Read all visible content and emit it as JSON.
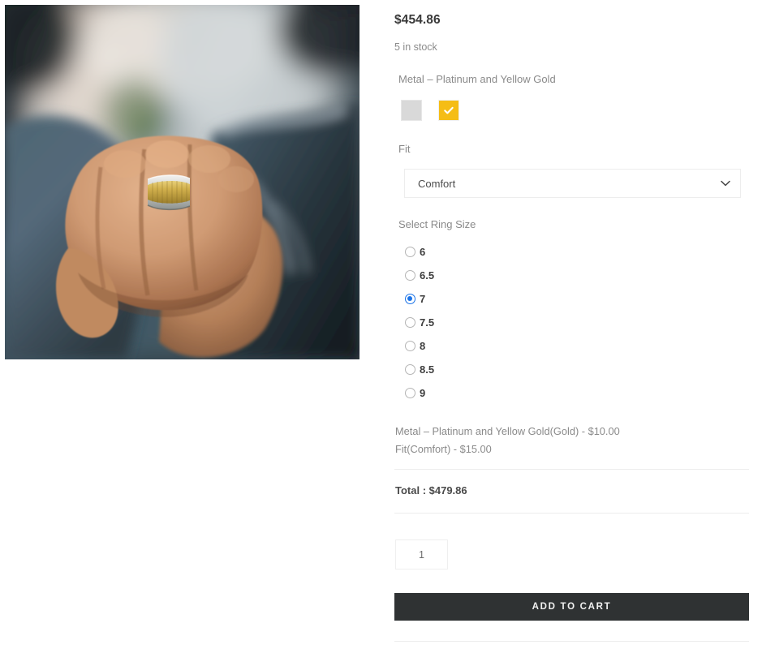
{
  "product": {
    "price": "$454.86",
    "stock_status": "5 in stock",
    "image_alt": "man's hand in a fist wearing a two-tone yellow gold and platinum wedding band, blue denim jacket"
  },
  "options": {
    "metal": {
      "label": "Metal – Platinum and Yellow Gold",
      "swatches": [
        {
          "name": "platinum",
          "color": "#d9d9d9",
          "selected": false
        },
        {
          "name": "gold",
          "color": "#f5bd15",
          "selected": true
        }
      ]
    },
    "fit": {
      "label": "Fit",
      "value": "Comfort",
      "options": [
        "Comfort"
      ]
    },
    "ring_size": {
      "label": "Select Ring Size",
      "selected": "7",
      "items": [
        {
          "label": "6",
          "selected": false
        },
        {
          "label": "6.5",
          "selected": false
        },
        {
          "label": "7",
          "selected": true
        },
        {
          "label": "7.5",
          "selected": false
        },
        {
          "label": "8",
          "selected": false
        },
        {
          "label": "8.5",
          "selected": false
        },
        {
          "label": "9",
          "selected": false
        }
      ]
    }
  },
  "addons": [
    "Metal – Platinum and Yellow Gold(Gold) - $10.00",
    "Fit(Comfort) - $15.00"
  ],
  "total": "Total : $479.86",
  "cart": {
    "quantity": "1",
    "quantity_placeholder": "1",
    "add_to_cart_label": "ADD TO CART"
  },
  "colors": {
    "accent_gold": "#f5bd15",
    "radio_selected": "#1a73e8",
    "button_background": "#2f3233",
    "muted_text": "#8a8a8a"
  }
}
